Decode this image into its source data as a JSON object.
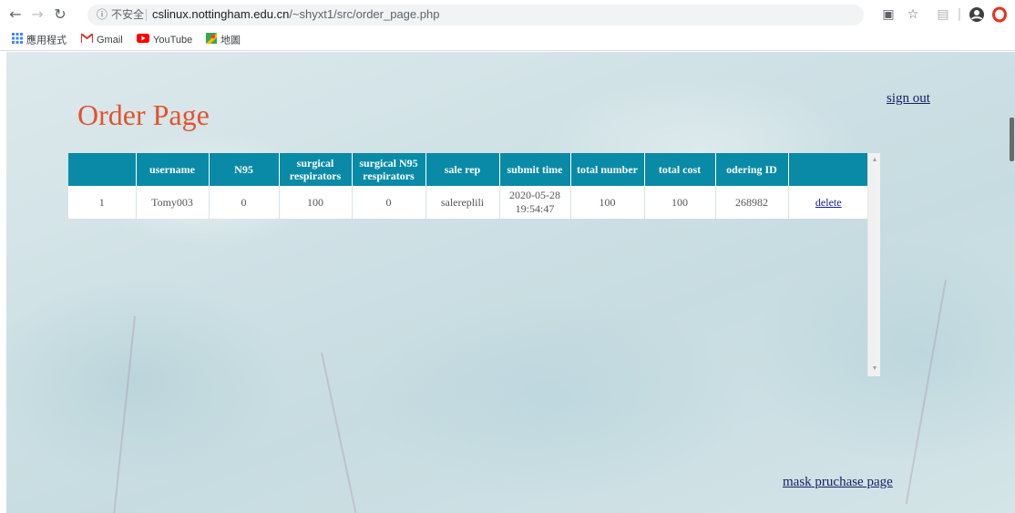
{
  "browser": {
    "info_icon": "info-icon",
    "insecure_label": "不安全",
    "url_host": "cslinux.nottingham.edu.cn",
    "url_path": "/~shyxt1/src/order_page.php",
    "bookmarks": [
      {
        "label": "應用程式",
        "icon": "apps-grid-icon"
      },
      {
        "label": "Gmail",
        "icon": "gmail-icon"
      },
      {
        "label": "YouTube",
        "icon": "youtube-icon"
      },
      {
        "label": "地圖",
        "icon": "maps-icon"
      }
    ]
  },
  "page": {
    "title": "Order Page",
    "sign_out": "sign out",
    "mask_link": "mask pruchase page"
  },
  "table": {
    "headers": [
      "",
      "username",
      "N95",
      "surgical respirators",
      "surgical N95 respirators",
      "sale rep",
      "submit time",
      "total number",
      "total cost",
      "odering ID",
      ""
    ],
    "rows": [
      {
        "index": "1",
        "username": "Tomy003",
        "n95": "0",
        "surgical": "100",
        "surgical_n95": "0",
        "sale_rep": "salereplili",
        "submit_time": "2020-05-28 19:54:47",
        "total_number": "100",
        "total_cost": "100",
        "order_id": "268982",
        "action": "delete"
      }
    ]
  },
  "colors": {
    "header_bg": "#098ba7",
    "title": "#e0542d",
    "link": "#1a1a66"
  }
}
